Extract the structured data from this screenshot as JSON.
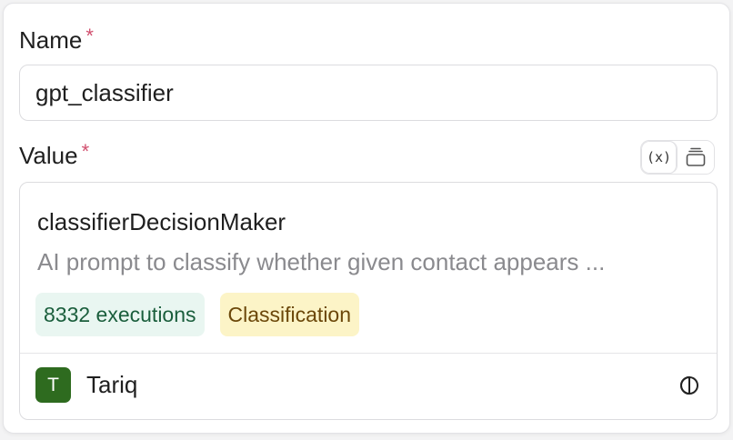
{
  "form": {
    "name_label": "Name",
    "name_required": "*",
    "name_value": "gpt_classifier",
    "value_label": "Value",
    "value_required": "*",
    "variable_toggle_label": "(x)"
  },
  "value_card": {
    "title": "classifierDecisionMaker",
    "description": "AI prompt to classify whether given contact appears ...",
    "executions_tag": "8332 executions",
    "category_tag": "Classification",
    "author_initial": "T",
    "author_name": "Tariq"
  },
  "icons": {
    "variable": "variable-icon",
    "layers": "stack-icon",
    "action": "half-circle-icon"
  },
  "colors": {
    "required": "#d14f6e",
    "avatar": "#2e6b1f",
    "executions_bg": "#e9f6f1",
    "executions_text": "#1a5e3c",
    "category_bg": "#fcf4c7",
    "category_text": "#6b4709"
  }
}
